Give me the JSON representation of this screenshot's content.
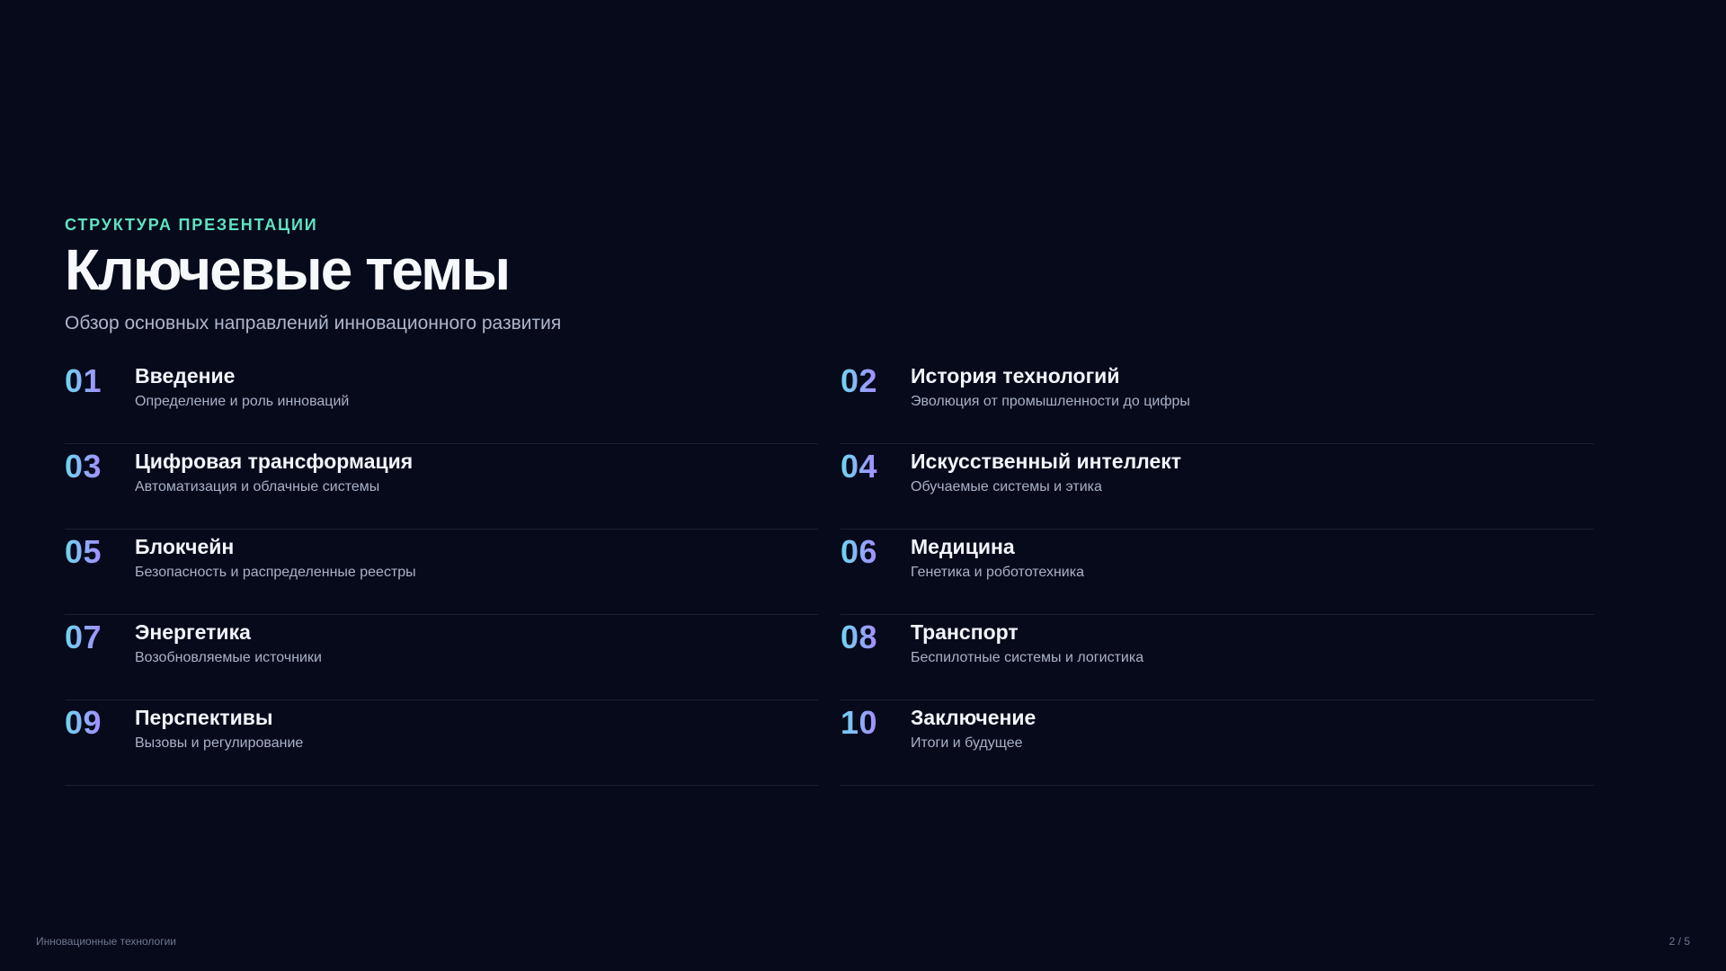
{
  "header": {
    "eyebrow": "СТРУКТУРА ПРЕЗЕНТАЦИИ",
    "title": "Ключевые темы",
    "subtitle": "Обзор основных направлений инновационного развития"
  },
  "items": [
    {
      "num": "01",
      "title": "Введение",
      "desc": "Определение и роль инноваций"
    },
    {
      "num": "02",
      "title": "История технологий",
      "desc": "Эволюция от промышленности до цифры"
    },
    {
      "num": "03",
      "title": "Цифровая трансформация",
      "desc": "Автоматизация и облачные системы"
    },
    {
      "num": "04",
      "title": "Искусственный интеллект",
      "desc": "Обучаемые системы и этика"
    },
    {
      "num": "05",
      "title": "Блокчейн",
      "desc": "Безопасность и распределенные реестры"
    },
    {
      "num": "06",
      "title": "Медицина",
      "desc": "Генетика и робототехника"
    },
    {
      "num": "07",
      "title": "Энергетика",
      "desc": "Возобновляемые источники"
    },
    {
      "num": "08",
      "title": "Транспорт",
      "desc": "Беспилотные системы и логистика"
    },
    {
      "num": "09",
      "title": "Перспективы",
      "desc": "Вызовы и регулирование"
    },
    {
      "num": "10",
      "title": "Заключение",
      "desc": "Итоги и будущее"
    }
  ],
  "footer": {
    "left": "Инновационные технологии",
    "right": "2 / 5"
  },
  "colors": {
    "background": "#060a1b",
    "accent": "#5fe3c0",
    "number_gradient_start": "#6fd6f0",
    "number_gradient_end": "#a48cff"
  }
}
